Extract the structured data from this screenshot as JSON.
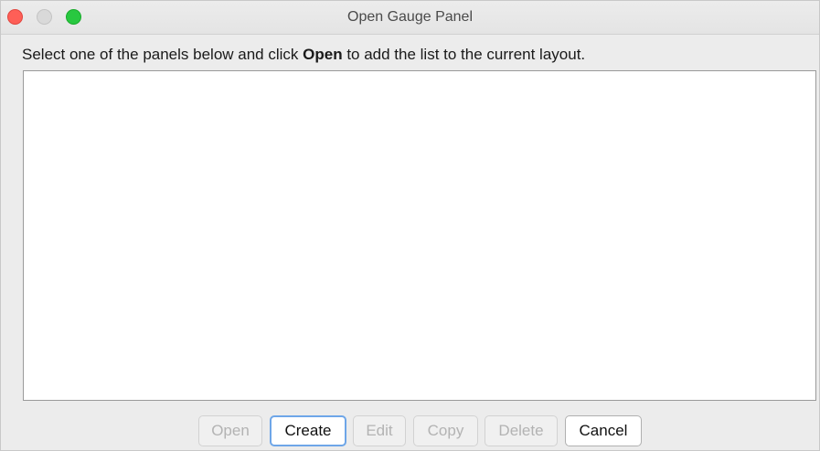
{
  "window": {
    "title": "Open Gauge Panel"
  },
  "instruction": {
    "prefix": "Select one of the panels below and click ",
    "bold": "Open",
    "suffix": " to add the list to the current layout."
  },
  "buttons": {
    "open": "Open",
    "create": "Create",
    "edit": "Edit",
    "copy": "Copy",
    "delete": "Delete",
    "cancel": "Cancel"
  },
  "colors": {
    "close_button": "#fe5f57",
    "minimize_button": "#d9d9d9",
    "zoom_button": "#28c840",
    "focus_ring": "#6ea6e8"
  }
}
